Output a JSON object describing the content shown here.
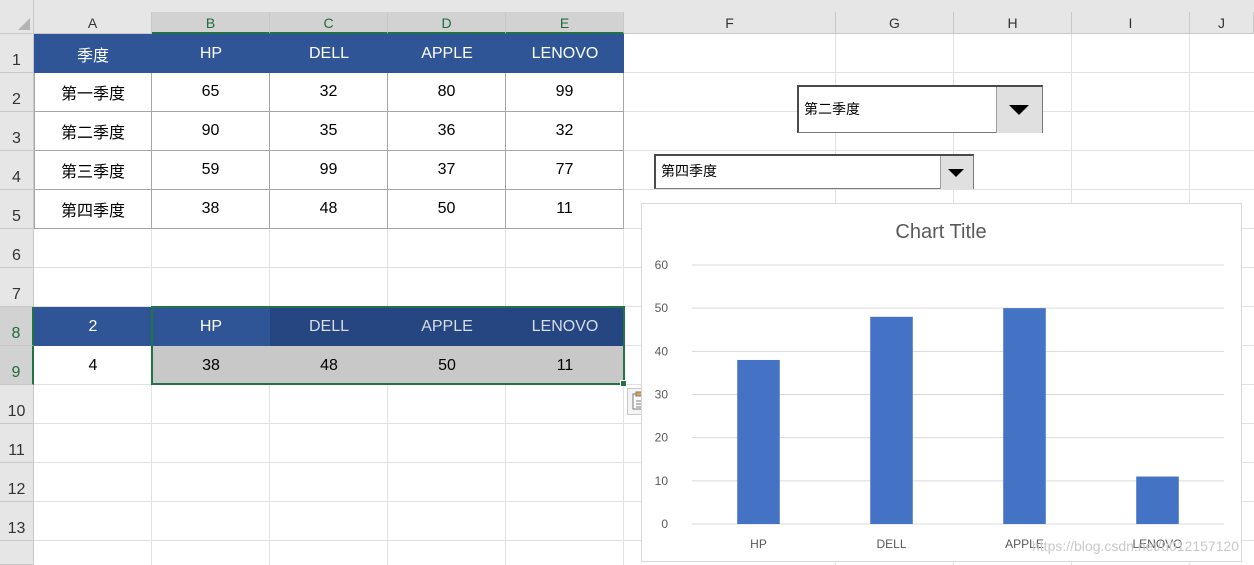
{
  "sheet": {
    "columns": [
      "A",
      "B",
      "C",
      "D",
      "E",
      "F",
      "G",
      "H",
      "I",
      "J"
    ],
    "rows": [
      "1",
      "2",
      "3",
      "4",
      "5",
      "6",
      "7",
      "8",
      "9",
      "10",
      "11",
      "12",
      "13"
    ]
  },
  "table": {
    "header": [
      "季度",
      "HP",
      "DELL",
      "APPLE",
      "LENOVO"
    ],
    "rows": [
      [
        "第一季度",
        "65",
        "32",
        "80",
        "99"
      ],
      [
        "第二季度",
        "90",
        "35",
        "36",
        "32"
      ],
      [
        "第三季度",
        "59",
        "99",
        "37",
        "77"
      ],
      [
        "第四季度",
        "38",
        "48",
        "50",
        "11"
      ]
    ]
  },
  "lookup": {
    "a8": "2",
    "a9": "4",
    "headers": [
      "HP",
      "DELL",
      "APPLE",
      "LENOVO"
    ],
    "values": [
      "38",
      "48",
      "50",
      "11"
    ]
  },
  "combo1": {
    "value": "第二季度"
  },
  "combo2": {
    "value": "第四季度"
  },
  "chart_data": {
    "type": "bar",
    "title": "Chart Title",
    "categories": [
      "HP",
      "DELL",
      "APPLE",
      "LENOVO"
    ],
    "values": [
      38,
      48,
      50,
      11
    ],
    "ylim": [
      0,
      60
    ],
    "yticks": [
      0,
      10,
      20,
      30,
      40,
      50,
      60
    ],
    "grid": true,
    "color": "#4472c4"
  },
  "watermark": "https://blog.csdn.net/u012157120",
  "colors": {
    "header_blue": "#2f5597",
    "selection_green": "#217346",
    "bar_blue": "#4472c4"
  }
}
